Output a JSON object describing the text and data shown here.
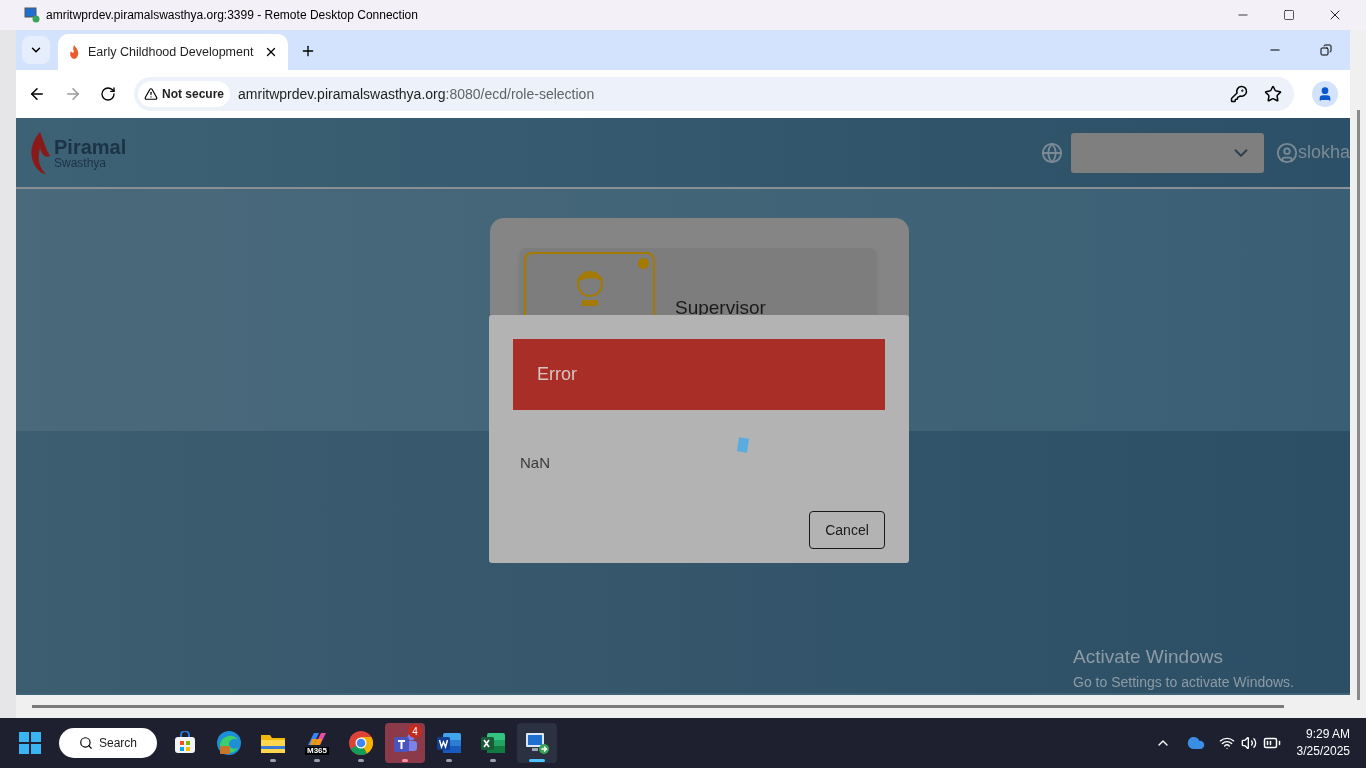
{
  "rdp_window": {
    "title": "amritwprdev.piramalswasthya.org:3399 - Remote Desktop Connection"
  },
  "browser": {
    "tabs": [
      {
        "label": "Early Childhood Development",
        "selected": true
      }
    ],
    "address": {
      "security": "Not secure",
      "host": "amritwprdev.piramalswasthya.org",
      "path": ":8080/ecd/role-selection"
    }
  },
  "page": {
    "logo": {
      "name": "Piramal",
      "sub": "Swasthya"
    },
    "user": "slokha",
    "role_card": {
      "label": "Supervisor"
    },
    "dialog": {
      "title": "Error",
      "message": "NaN",
      "buttons": [
        "Cancel"
      ]
    }
  },
  "activation_notice": {
    "title": "Activate Windows",
    "subtitle": "Go to Settings to activate Windows."
  },
  "taskbar": {
    "search": "Search",
    "apps": [
      {
        "kind": "store",
        "running": false,
        "alert": false,
        "selected": false
      },
      {
        "kind": "edge",
        "running": false,
        "alert": false,
        "selected": false
      },
      {
        "kind": "explorer",
        "running": true,
        "alert": false,
        "selected": false
      },
      {
        "kind": "m365",
        "label": "M365",
        "running": true,
        "alert": false,
        "selected": false
      },
      {
        "kind": "chrome",
        "running": true,
        "alert": false,
        "selected": false
      },
      {
        "kind": "teams",
        "badge": "4",
        "running": true,
        "alert": true,
        "selected": false
      },
      {
        "kind": "word",
        "running": true,
        "alert": false,
        "selected": false
      },
      {
        "kind": "excel",
        "running": true,
        "alert": false,
        "selected": false
      },
      {
        "kind": "rdp",
        "running": true,
        "alert": false,
        "selected": true
      }
    ],
    "time": "9:29 AM",
    "date": "3/25/2025"
  }
}
